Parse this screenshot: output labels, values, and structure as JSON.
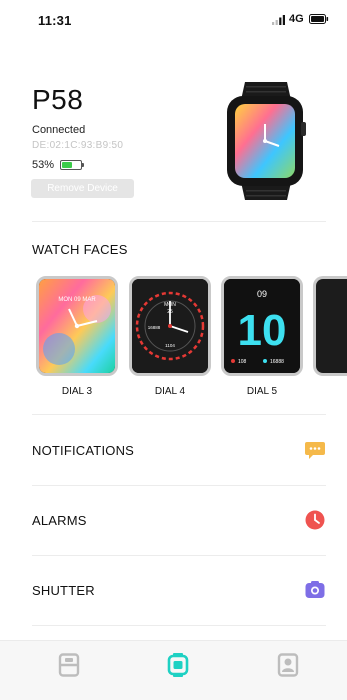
{
  "status_bar": {
    "time": "11:31",
    "network": "4G"
  },
  "device": {
    "name": "P58",
    "status": "Connected",
    "mac": "DE:02:1C:93:B9:50",
    "battery_percent": "53%",
    "battery_level": 0.53,
    "remove_label": "Remove Device"
  },
  "watch_faces": {
    "title": "WATCH FACES",
    "dials": [
      {
        "label": "DIAL 3",
        "face_text": "MON 09 MAR"
      },
      {
        "label": "DIAL 4",
        "face_text_top": "MON",
        "face_text_mid": "25",
        "face_text_left": "16888",
        "face_text_bottom": "1104"
      },
      {
        "label": "DIAL 5",
        "face_time_top": "09",
        "face_time_big": "10",
        "face_text_left": "108",
        "face_text_right": "16888"
      }
    ]
  },
  "menu": [
    {
      "label": "NOTIFICATIONS",
      "icon": "message-icon",
      "color": "#f5b94a"
    },
    {
      "label": "ALARMS",
      "icon": "clock-icon",
      "color": "#ef5350"
    },
    {
      "label": "SHUTTER",
      "icon": "camera-icon",
      "color": "#7e6ee6"
    }
  ],
  "tabs": [
    {
      "icon": "dashboard-icon",
      "color": "#bdbdbd"
    },
    {
      "icon": "watch-icon",
      "color": "#1fd1c3"
    },
    {
      "icon": "profile-icon",
      "color": "#bdbdbd"
    }
  ]
}
